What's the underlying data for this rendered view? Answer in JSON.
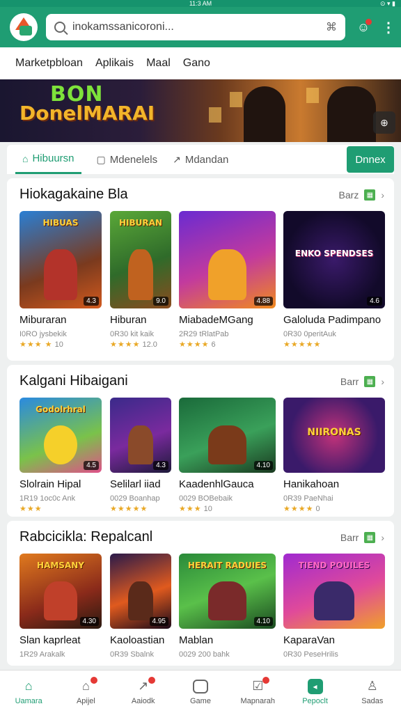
{
  "status": {
    "time": "11:3 AM",
    "icons": "⊙ ▾ ▮"
  },
  "header": {
    "search_value": "inokamssanicoroni..."
  },
  "top_nav": [
    "Marketpbloan",
    "Aplikais",
    "Maal",
    "Gano"
  ],
  "banner": {
    "line1": "BON",
    "line2": "DonelMARAI"
  },
  "tabs": {
    "items": [
      "Hibuursn",
      "Mdenelels",
      "Mdandan"
    ],
    "action": "Dnnex"
  },
  "sections": [
    {
      "title": "Hiokagakaine Bla",
      "more": "Barz",
      "apps": [
        {
          "name": "Miburaran",
          "sub": "I0RO jysbekik",
          "rating": "10",
          "tag": "4.3",
          "art": "HIBUAS"
        },
        {
          "name": "Hiburan",
          "sub": "0R30 kit kaik",
          "rating": "12.0",
          "tag": "9.0",
          "art": "HIBURAN"
        },
        {
          "name": "MiabadeMGang",
          "sub": "2R29 tRlatPab",
          "rating": "6",
          "tag": "4.88",
          "art": ""
        },
        {
          "name": "Galoluda Padimpano",
          "sub": "0R30 0peritAuk",
          "rating": "",
          "tag": "4.6",
          "art": "ENKO SPENDSES"
        }
      ]
    },
    {
      "title": "Kalgani Hibaigani",
      "more": "Barr",
      "apps": [
        {
          "name": "Slolrain Hipal",
          "sub": "1R19 1oc0c Ank",
          "rating": "",
          "tag": "4.5",
          "art": "Godolrhral"
        },
        {
          "name": "Selilarl iiad",
          "sub": "0029 Boanhap",
          "rating": "",
          "tag": "4.3",
          "art": ""
        },
        {
          "name": "KaadenhlGauca",
          "sub": "0029 BOBebaik",
          "rating": "10",
          "tag": "4.10",
          "art": ""
        },
        {
          "name": "Hanikahoan",
          "sub": "0R39 PaeNhai",
          "rating": "0",
          "tag": "",
          "art": "NIIRONAS"
        }
      ]
    },
    {
      "title": "Rabcicikla: Repalcanl",
      "more": "Barr",
      "apps": [
        {
          "name": "Slan kaprleat",
          "sub": "1R29 Arakalk",
          "rating": "",
          "tag": "4.30",
          "art": "HAMSANY"
        },
        {
          "name": "Kaoloastian",
          "sub": "0R39 Sbalnk",
          "rating": "",
          "tag": "4.95",
          "art": ""
        },
        {
          "name": "Mablan",
          "sub": "0029 200 bahk",
          "rating": "",
          "tag": "4.10",
          "art": "HERAIT RADUIES"
        },
        {
          "name": "KaparaVan",
          "sub": "0R30 PeseHrilis",
          "rating": "",
          "tag": "",
          "art": "TIEND POUILES"
        }
      ]
    }
  ],
  "bottom_nav": [
    "Uamara",
    "Apijel",
    "Aaiodk",
    "Game",
    "Mapnarah",
    "Pepoclt",
    "Sadas"
  ],
  "colors": {
    "primary": "#1f9d73",
    "star": "#e9a825",
    "badge": "#e53935"
  }
}
